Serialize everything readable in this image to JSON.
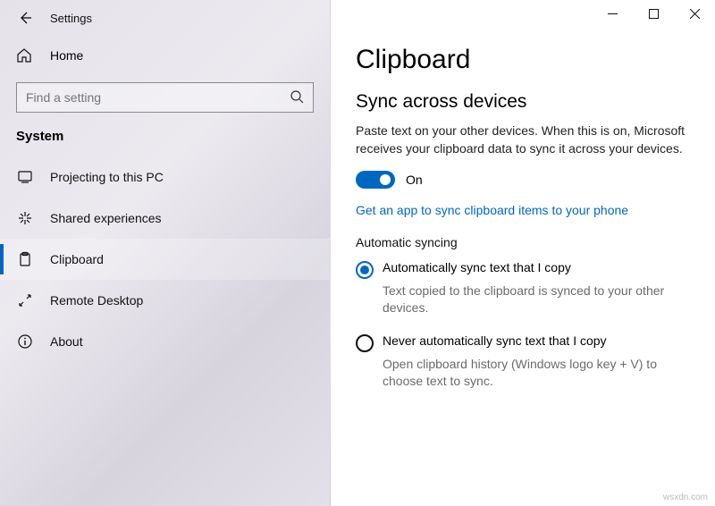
{
  "titlebar": {
    "title": "Settings"
  },
  "home": {
    "label": "Home"
  },
  "search": {
    "placeholder": "Find a setting"
  },
  "category": "System",
  "nav": [
    {
      "label": "Projecting to this PC"
    },
    {
      "label": "Shared experiences"
    },
    {
      "label": "Clipboard"
    },
    {
      "label": "Remote Desktop"
    },
    {
      "label": "About"
    }
  ],
  "page": {
    "title": "Clipboard",
    "section": "Sync across devices",
    "desc": "Paste text on your other devices. When this is on, Microsoft receives your clipboard data to sync it across your devices.",
    "toggle_label": "On",
    "link": "Get an app to sync clipboard items to your phone",
    "subhead": "Automatic syncing",
    "radios": [
      {
        "label": "Automatically sync text that I copy",
        "desc": "Text copied to the clipboard is synced to your other devices."
      },
      {
        "label": "Never automatically sync text that I copy",
        "desc": "Open clipboard history (Windows logo key + V) to choose text to sync."
      }
    ]
  },
  "watermark": "wsxdn.com"
}
